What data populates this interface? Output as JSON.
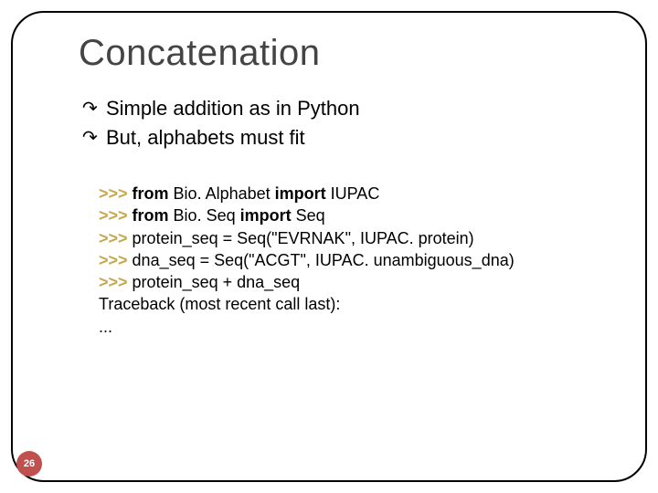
{
  "title": "Concatenation",
  "bullets": [
    "Simple addition as in Python",
    "But, alphabets must fit"
  ],
  "bullet_marker": "↷",
  "code": {
    "prompt": ">>>",
    "lines": [
      {
        "kind": "stmt",
        "segs": [
          {
            "t": "from",
            "b": true
          },
          {
            "t": " Bio. Alphabet "
          },
          {
            "t": "import",
            "b": true
          },
          {
            "t": " IUPAC"
          }
        ]
      },
      {
        "kind": "stmt",
        "segs": [
          {
            "t": "from",
            "b": true
          },
          {
            "t": " Bio. Seq "
          },
          {
            "t": "import",
            "b": true
          },
          {
            "t": " Seq"
          }
        ]
      },
      {
        "kind": "stmt",
        "segs": [
          {
            "t": "protein_seq = Seq(\"EVRNAK\", IUPAC. protein)"
          }
        ]
      },
      {
        "kind": "stmt",
        "segs": [
          {
            "t": "dna_seq = Seq(\"ACGT\", IUPAC. unambiguous_dna)"
          }
        ]
      },
      {
        "kind": "stmt",
        "segs": [
          {
            "t": "protein_seq + dna_seq"
          }
        ]
      },
      {
        "kind": "out",
        "segs": [
          {
            "t": "Traceback (most recent call last):"
          }
        ]
      },
      {
        "kind": "out",
        "segs": [
          {
            "t": "..."
          }
        ]
      }
    ]
  },
  "page_number": "26"
}
